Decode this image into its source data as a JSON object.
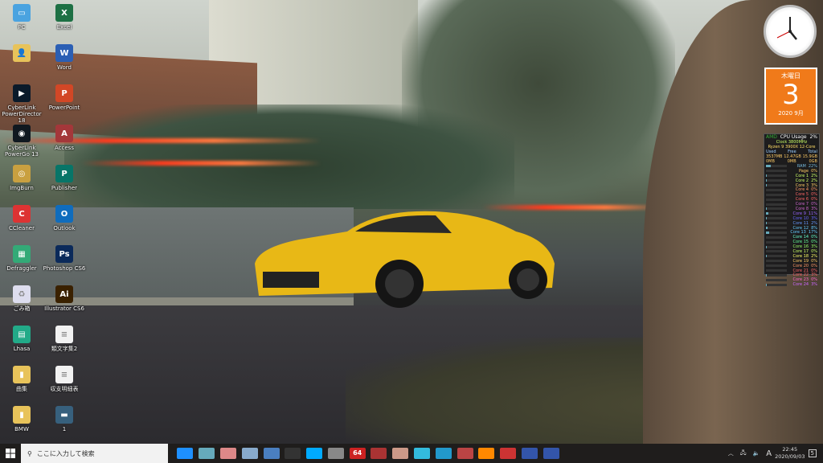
{
  "desktop": {
    "icons_col1": [
      {
        "label": "PC",
        "color": "#4aa3e0",
        "glyph": "▭"
      },
      {
        "label": "",
        "color": "#e8c35a",
        "glyph": "👤"
      },
      {
        "label": "CyberLink PowerDirector 18",
        "color": "#0a1a2a",
        "glyph": "▶"
      },
      {
        "label": "CyberLink PowerGo 13",
        "color": "#101820",
        "glyph": "◉"
      },
      {
        "label": "ImgBurn",
        "color": "#c9a040",
        "glyph": "◎"
      },
      {
        "label": "CCleaner",
        "color": "#d33",
        "glyph": "C"
      },
      {
        "label": "Defraggler",
        "color": "#3a7",
        "glyph": "▦"
      },
      {
        "label": "ごみ箱",
        "color": "#dde",
        "glyph": "♻"
      },
      {
        "label": "Lhasa",
        "color": "#2a8",
        "glyph": "▤"
      },
      {
        "label": "曲集",
        "color": "#e8c35a",
        "glyph": "▮"
      },
      {
        "label": "BMW",
        "color": "#e8c35a",
        "glyph": "▮"
      }
    ],
    "icons_col2": [
      {
        "label": "Excel",
        "color": "#1d7044",
        "glyph": "X"
      },
      {
        "label": "Word",
        "color": "#2b5fb4",
        "glyph": "W"
      },
      {
        "label": "PowerPoint",
        "color": "#d24726",
        "glyph": "P"
      },
      {
        "label": "Access",
        "color": "#a4373a",
        "glyph": "A"
      },
      {
        "label": "Publisher",
        "color": "#077568",
        "glyph": "P"
      },
      {
        "label": "Outlook",
        "color": "#0f6cbd",
        "glyph": "O"
      },
      {
        "label": "Photoshop CS6",
        "color": "#0b2a5a",
        "glyph": "Ps"
      },
      {
        "label": "Illustrator CS6",
        "color": "#3a2100",
        "glyph": "Ai"
      },
      {
        "label": "類文字集2",
        "color": "#f2f2f2",
        "glyph": "≡"
      },
      {
        "label": "収支明細表",
        "color": "#f2f2f2",
        "glyph": "≡"
      },
      {
        "label": "1",
        "color": "#37607d",
        "glyph": "▬"
      }
    ]
  },
  "calendar": {
    "weekday": "木曜日",
    "day": "3",
    "month": "2020 9月"
  },
  "cpu": {
    "title": "CPU Usage",
    "total": "2%",
    "clock": "Clock 3800MHz",
    "model": "Ryzen 9 3900X 12-Core",
    "mem_headers": [
      "Used",
      "Free",
      "Total"
    ],
    "mem_values": [
      "3537MB",
      "12.47GB",
      "15.9GB"
    ],
    "page_values": [
      "0MB",
      "0MB",
      "0GB"
    ],
    "rows": [
      {
        "name": "RAM",
        "pct": "22%"
      },
      {
        "name": "Page",
        "pct": "0%"
      },
      {
        "name": "Core 1",
        "pct": "2%"
      },
      {
        "name": "Core 2",
        "pct": "2%"
      },
      {
        "name": "Core 3",
        "pct": "3%"
      },
      {
        "name": "Core 4",
        "pct": "0%"
      },
      {
        "name": "Core 5",
        "pct": "0%"
      },
      {
        "name": "Core 6",
        "pct": "0%"
      },
      {
        "name": "Core 7",
        "pct": "0%"
      },
      {
        "name": "Core 8",
        "pct": "3%"
      },
      {
        "name": "Core 9",
        "pct": "11%"
      },
      {
        "name": "Core 10",
        "pct": "3%"
      },
      {
        "name": "Core 11",
        "pct": "2%"
      },
      {
        "name": "Core 12",
        "pct": "8%"
      },
      {
        "name": "Core 13",
        "pct": "17%"
      },
      {
        "name": "Core 14",
        "pct": "0%"
      },
      {
        "name": "Core 15",
        "pct": "0%"
      },
      {
        "name": "Core 16",
        "pct": "3%"
      },
      {
        "name": "Core 17",
        "pct": "0%"
      },
      {
        "name": "Core 18",
        "pct": "2%"
      },
      {
        "name": "Core 19",
        "pct": "0%"
      },
      {
        "name": "Core 20",
        "pct": "0%"
      },
      {
        "name": "Core 21",
        "pct": "0%"
      },
      {
        "name": "Core 22",
        "pct": "3%"
      },
      {
        "name": "Core 23",
        "pct": "0%"
      },
      {
        "name": "Core 24",
        "pct": "3%"
      }
    ],
    "row_colors": [
      "#7bd",
      "#fc6",
      "#cf6",
      "#cf6",
      "#fc6",
      "#f96",
      "#f66",
      "#f66",
      "#c6c",
      "#c6c",
      "#96f",
      "#66f",
      "#69f",
      "#6cf",
      "#6cf",
      "#6fc",
      "#6f9",
      "#9f6",
      "#cf6",
      "#ff6",
      "#fc6",
      "#f96",
      "#f66",
      "#f66",
      "#f6c",
      "#c6f"
    ]
  },
  "taskbar": {
    "search_placeholder": "ここに入力して検索",
    "pinned": [
      {
        "name": "internet-explorer",
        "color": "#1e90ff"
      },
      {
        "name": "app-blue",
        "color": "#6ab"
      },
      {
        "name": "app-paint",
        "color": "#d88"
      },
      {
        "name": "app-globe",
        "color": "#8ac"
      },
      {
        "name": "calculator",
        "color": "#4a7fc0"
      },
      {
        "name": "terminal",
        "color": "#333"
      },
      {
        "name": "app-face",
        "color": "#0af"
      },
      {
        "name": "app-gray",
        "color": "#888"
      },
      {
        "name": "app-64",
        "color": "#c22",
        "text": "64"
      },
      {
        "name": "app-red",
        "color": "#a33"
      },
      {
        "name": "app-avatar",
        "color": "#c98"
      },
      {
        "name": "app-snow",
        "color": "#3bd"
      },
      {
        "name": "app-chart",
        "color": "#29c"
      },
      {
        "name": "app-dragon",
        "color": "#b44"
      },
      {
        "name": "blender",
        "color": "#f80"
      },
      {
        "name": "app-rotate",
        "color": "#c33"
      },
      {
        "name": "cinema4d",
        "color": "#35a"
      },
      {
        "name": "cinema4d-2",
        "color": "#35a"
      }
    ],
    "ime": "A",
    "time": "22:45",
    "date": "2020/09/03",
    "notifications": "5"
  }
}
